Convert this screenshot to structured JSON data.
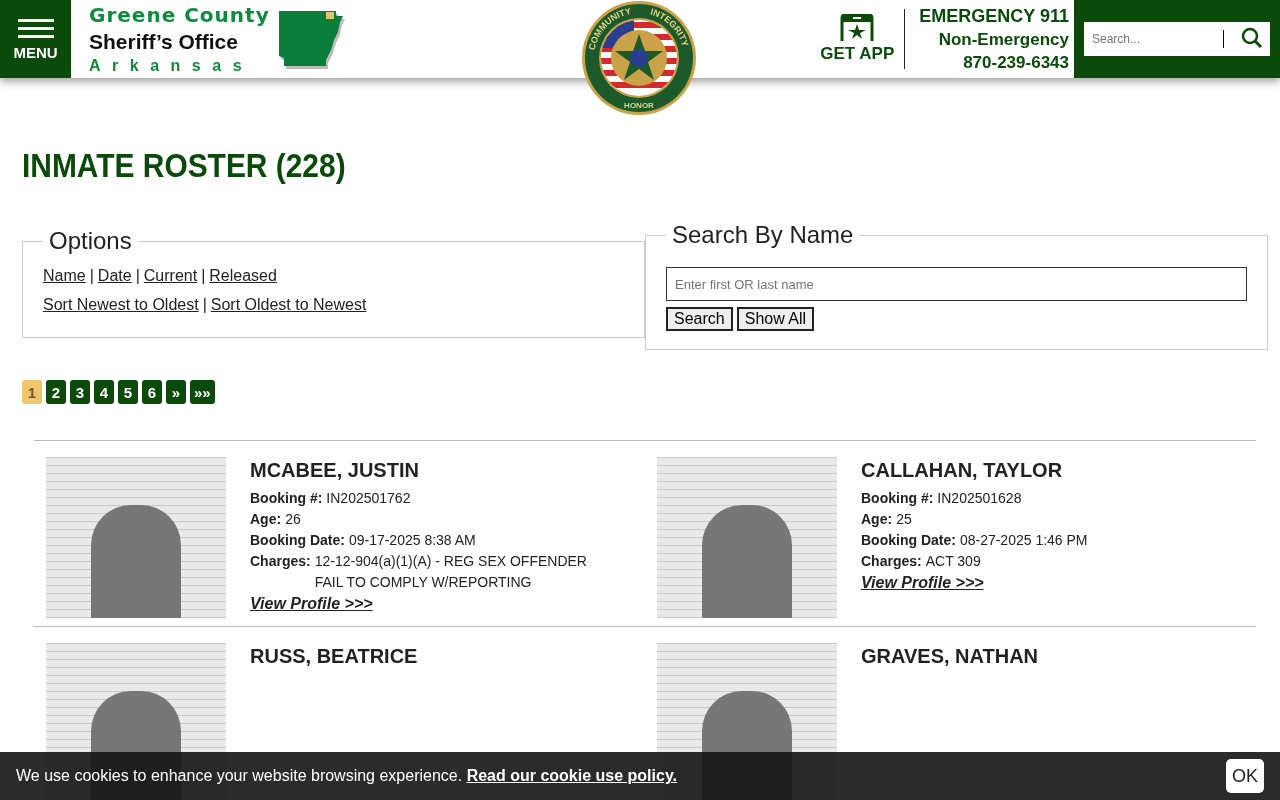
{
  "header": {
    "menu_label": "MENU",
    "logo": {
      "line1": "Greene County",
      "line2": "Sheriff’s Office",
      "line3": "Arkansas"
    },
    "badge": {
      "top_left": "COMMUNITY",
      "top_right": "INTEGRITY",
      "bottom": "HONOR"
    },
    "get_app": "GET APP",
    "emergency": "EMERGENCY 911",
    "non_emergency": "Non-Emergency",
    "phone": "870-239-6343",
    "search": {
      "placeholder": "Search..."
    }
  },
  "title": "INMATE ROSTER (228)",
  "options": {
    "legend": "Options",
    "filter_links": [
      {
        "kind": "link",
        "text": "Name"
      },
      {
        "kind": "separator",
        "text": "|"
      },
      {
        "kind": "link",
        "text": "Date"
      },
      {
        "kind": "separator",
        "text": "|"
      },
      {
        "kind": "link",
        "text": "Current"
      },
      {
        "kind": "separator",
        "text": "|"
      },
      {
        "kind": "link",
        "text": "Released"
      }
    ],
    "sort_links": [
      {
        "kind": "link",
        "text": "Sort Newest to Oldest"
      },
      {
        "kind": "separator",
        "text": "|"
      },
      {
        "kind": "link",
        "text": "Sort Oldest to Newest"
      }
    ]
  },
  "search_by_name": {
    "legend": "Search By Name",
    "placeholder": "Enter first OR last name",
    "buttons": [
      "Search",
      "Show All"
    ]
  },
  "pagination": [
    {
      "label": "1",
      "selected": true
    },
    {
      "label": "2",
      "selected": false
    },
    {
      "label": "3",
      "selected": false
    },
    {
      "label": "4",
      "selected": false
    },
    {
      "label": "5",
      "selected": false
    },
    {
      "label": "6",
      "selected": false
    },
    {
      "label": "»",
      "selected": false
    },
    {
      "label": "»»",
      "selected": false
    }
  ],
  "inmates": [
    {
      "name": "MCABEE, JUSTIN",
      "fields": [
        {
          "label": "Booking #:",
          "value": "IN202501762"
        },
        {
          "label": "Age:",
          "value": "26"
        },
        {
          "label": "Booking Date:",
          "value": "09-17-2025 8:38 AM"
        },
        {
          "label": "Charges:",
          "value": "12-12-904(a)(1)(A) - REG SEX OFFENDER FAIL TO COMPLY W/REPORTING"
        }
      ],
      "link": "View Profile >>>"
    },
    {
      "name": "CALLAHAN, TAYLOR",
      "fields": [
        {
          "label": "Booking #:",
          "value": "IN202501628"
        },
        {
          "label": "Age:",
          "value": "25"
        },
        {
          "label": "Booking Date:",
          "value": "08-27-2025 1:46 PM"
        },
        {
          "label": "Charges:",
          "value": "ACT 309"
        }
      ],
      "link": "View Profile >>>"
    },
    {
      "name": "RUSS, BEATRICE"
    },
    {
      "name": "GRAVES, NATHAN"
    }
  ],
  "cookie": {
    "text": "We use cookies to enhance your website browsing experience.",
    "link": "Read our cookie use policy.",
    "button": "OK"
  }
}
